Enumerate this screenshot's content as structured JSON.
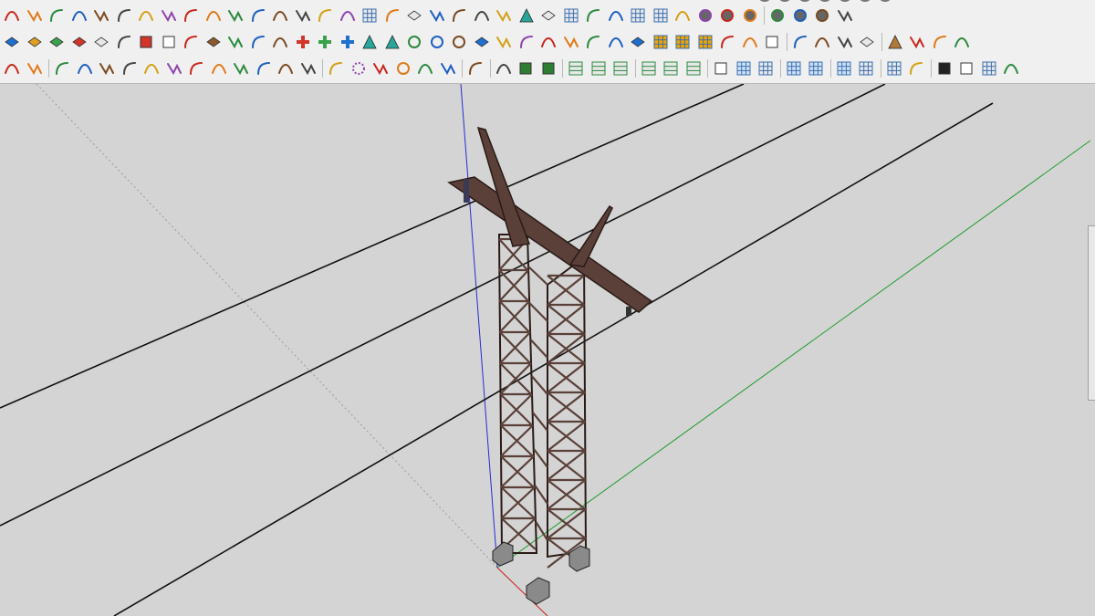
{
  "window": {
    "background": "#d4d4d4",
    "toolbar_bg": "#f0f0f0"
  },
  "toolbars": {
    "row1": [
      "freehand-curve-icon",
      "eraser-plus-icon",
      "curve-cut-icon",
      "rotate-shape-icon",
      "cloud-shape-icon",
      "offset-curve-icon",
      "loft-surface-icon",
      "bezier-icon",
      "angle-icon",
      "corner-icon",
      "corner-bevel-icon",
      "angle-split-icon",
      "sweep-icon",
      "profile-icon",
      "mesh-icon",
      "stack-icon",
      "grid-block-icon",
      "hand-pan-icon",
      "scale-diamond-icon",
      "stair-icon",
      "flip-arrow-icon",
      "flip-arrow-alt-icon",
      "fold-arrow-icon",
      "roof-icon",
      "slab-icon",
      "stripes-icon",
      "wave-icon",
      "stepped-icon",
      "stripes-2-icon",
      "stripes-3-icon",
      "column-icon",
      "sphere-1-icon",
      "sphere-2-icon",
      "sphere-3-icon",
      "sphere-4-icon",
      "sphere-5-icon",
      "sphere-6-icon",
      "hexagon-icon"
    ],
    "row2": [
      "blue-gem-icon",
      "orange-slab-icon",
      "green-slab-icon",
      "red-slab-icon",
      "white-slab-icon",
      "orange-pacman-icon",
      "red-square-icon",
      "list-box-icon",
      "flag-icon",
      "wood-block-icon",
      "curve-tube-icon",
      "corner-pipe-icon",
      "dotted-path-icon",
      "red-cross-icon",
      "green-cross-icon",
      "blue-x-icon",
      "cone-icon",
      "cone-alt-icon",
      "ring-icon",
      "orange-ring-icon",
      "loop-icon",
      "blue-diamond-icon",
      "brown-pot-icon",
      "red-magnet-icon",
      "green-puzzle-icon",
      "mixed-1-icon",
      "mixed-2-icon",
      "mixed-3-icon",
      "blue-tile-icon",
      "orange-grid-icon",
      "yellow-grid-icon",
      "orange-grid-2-icon",
      "red-dots-icon",
      "dotted-arc-icon",
      "dotted-square-icon",
      "pencil-icon",
      "crane-icon",
      "blue-twist-icon",
      "folded-slab-icon",
      "tent-icon",
      "blue-pen-icon",
      "hook-icon",
      "balance-icon"
    ],
    "row3": [
      "select-node-icon",
      "green-mesh-icon",
      "curve-v-icon",
      "curve-n-icon",
      "curve-w-icon",
      "curve-n2-icon",
      "curve-s-icon",
      "arc-c-icon",
      "rounded-rect-icon",
      "spiral-icon",
      "arc-open-icon",
      "curve-u-icon",
      "arc-small-icon",
      "arc-red-icon",
      "line-icon",
      "dotted-circle-icon",
      "wrench-icon",
      "red-circle-icon",
      "red-tag-icon",
      "green-book-icon",
      "green-star-icon",
      "arrow-select-icon",
      "green-box-icon",
      "green-box-arrow-icon",
      "hlines-green-icon",
      "hlines-plus-icon",
      "hlines-minus-icon",
      "hline-icon",
      "hline-plus-icon",
      "hline-minus-icon",
      "blue-square-diag-icon",
      "blue-grid-diag-icon",
      "red-grid-diag-icon",
      "blue-grid-icon",
      "blue-grid-2-icon",
      "blue-grid-3-icon",
      "perspective-grid-icon",
      "textured-grid-icon",
      "dome-icon",
      "checker-icon",
      "small-squares-icon",
      "grid-arrows-icon",
      "axes-icon"
    ]
  },
  "scene": {
    "axes": {
      "red": "#cc1a1a",
      "green": "#1e9a2b",
      "blue": "#2a2ad0"
    },
    "tower_color": "#5a4038",
    "tower_edge": "#2a1a16",
    "footing_color": "#8a8a8a",
    "cable_color": "#111111"
  }
}
